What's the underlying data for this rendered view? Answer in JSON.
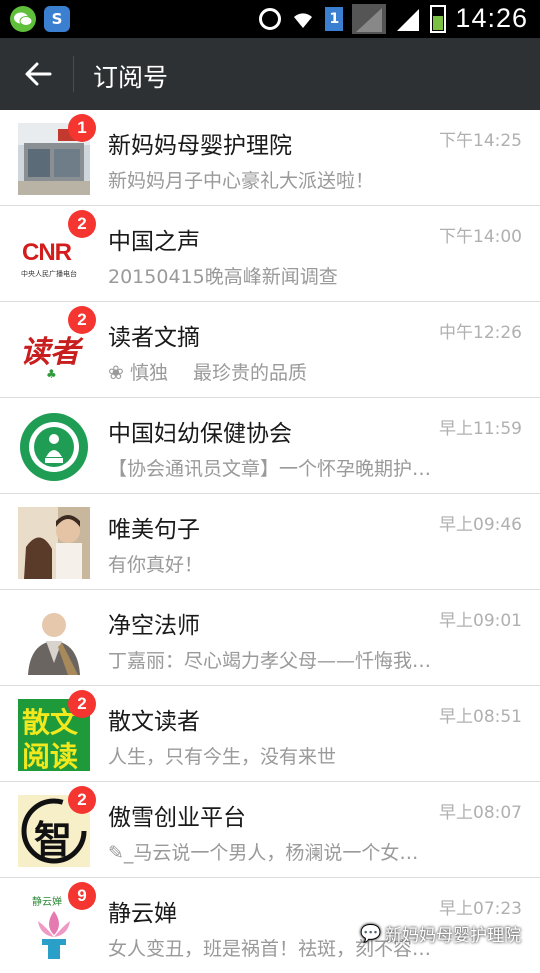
{
  "status_bar": {
    "time": "14:26",
    "sim_label": "1",
    "s_label": "S",
    "icons": [
      "wechat-icon",
      "s-app-icon",
      "alarm-icon",
      "wifi-icon",
      "sim-icon",
      "signal-icon",
      "signal-icon",
      "battery-icon"
    ]
  },
  "header": {
    "title": "订阅号",
    "back_icon": "arrow-left-icon"
  },
  "items": [
    {
      "name": "新妈妈母婴护理院",
      "time": "下午14:25",
      "preview": "新妈妈月子中心豪礼大派送啦！",
      "badge": "1"
    },
    {
      "name": "中国之声",
      "time": "下午14:00",
      "preview": "20150415晚高峰新闻调查",
      "badge": "2"
    },
    {
      "name": "读者文摘",
      "time": "中午12:26",
      "preview": "慎独　 最珍贵的品质",
      "badge": "2"
    },
    {
      "name": "中国妇幼保健协会",
      "time": "早上11:59",
      "preview": "【协会通讯员文章】一个怀孕晚期护…",
      "badge": ""
    },
    {
      "name": "唯美句子",
      "time": "早上09:46",
      "preview": "有你真好！",
      "badge": ""
    },
    {
      "name": "净空法师",
      "time": "早上09:01",
      "preview": "丁嘉丽：尽心竭力孝父母——忏悔我…",
      "badge": ""
    },
    {
      "name": "散文读者",
      "time": "早上08:51",
      "preview": "人生，只有今生，没有来世",
      "badge": "2"
    },
    {
      "name": "傲雪创业平台",
      "time": "早上08:07",
      "preview": "_马云说一个男人，杨澜说一个女…",
      "badge": "2"
    },
    {
      "name": "静云婵",
      "time": "早上07:23",
      "preview": "女人变丑，班是祸首！祛斑，刻不容…",
      "badge": "9"
    }
  ],
  "avatars": {
    "cnr_text": "CNR",
    "cnr_sub": "中央人民广播电台",
    "duzhe_text": "读者",
    "sanwen_line1": "散文",
    "sanwen_line2": "阅读",
    "aoxue_char": "智",
    "jingyun_text": "静云婵"
  },
  "watermark": "新妈妈母婴护理院",
  "colors": {
    "header_bg": "#2e3134",
    "badge": "#f43530",
    "status_bg": "#000000"
  }
}
